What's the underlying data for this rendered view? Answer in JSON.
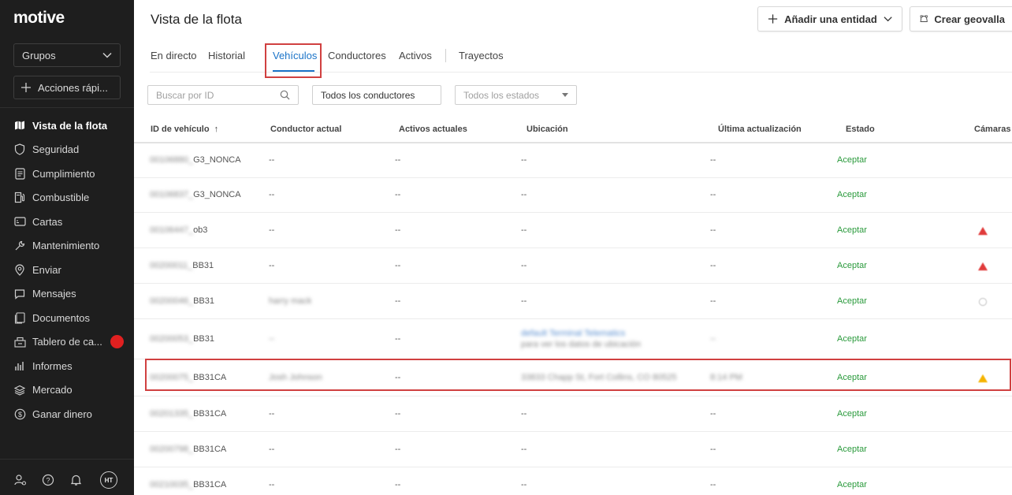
{
  "sidebar": {
    "logo": "motive",
    "groups_label": "Grupos",
    "quick_actions_label": "Acciones rápi...",
    "items": [
      {
        "label": "Vista de la flota",
        "icon": "map-icon",
        "active": true
      },
      {
        "label": "Seguridad",
        "icon": "shield-icon",
        "active": false
      },
      {
        "label": "Cumplimiento",
        "icon": "document-list-icon",
        "active": false
      },
      {
        "label": "Combustible",
        "icon": "fuel-pump-icon",
        "active": false
      },
      {
        "label": "Cartas",
        "icon": "card-icon",
        "active": false
      },
      {
        "label": "Mantenimiento",
        "icon": "wrench-icon",
        "active": false
      },
      {
        "label": "Enviar",
        "icon": "location-gear-icon",
        "active": false
      },
      {
        "label": "Mensajes",
        "icon": "message-icon",
        "active": false
      },
      {
        "label": "Documentos",
        "icon": "documents-icon",
        "active": false
      },
      {
        "label": "Tablero de ca...",
        "icon": "dashboard-icon",
        "active": false,
        "badge": true
      },
      {
        "label": "Informes",
        "icon": "bar-chart-icon",
        "active": false
      },
      {
        "label": "Mercado",
        "icon": "layers-icon",
        "active": false
      },
      {
        "label": "Ganar dinero",
        "icon": "dollar-icon",
        "active": false
      }
    ],
    "avatar_initials": "HT"
  },
  "header": {
    "title": "Vista de la flota",
    "add_entity_label": "Añadir una entidad",
    "create_geofence_label": "Crear geovalla"
  },
  "tabs": [
    {
      "label": "En directo",
      "active": false
    },
    {
      "label": "Historial",
      "active": false
    },
    {
      "label": "Vehículos",
      "active": true
    },
    {
      "label": "Conductores",
      "active": false
    },
    {
      "label": "Activos",
      "active": false
    },
    {
      "label": "Trayectos",
      "active": false
    }
  ],
  "filters": {
    "search_placeholder": "Buscar por ID",
    "drivers_value": "Todos los conductores",
    "status_placeholder": "Todos los estados"
  },
  "table": {
    "columns": [
      "ID de vehículo",
      "Conductor actual",
      "Activos actuales",
      "Ubicación",
      "Última actualización",
      "Estado",
      "Cámaras"
    ],
    "sort_indicator": "↑",
    "rows": [
      {
        "id_hidden": "00106880_",
        "id_suffix": "G3_NONCA",
        "driver": "--",
        "driver_blur": false,
        "assets": "--",
        "location": "--",
        "location2": "",
        "location_blur": false,
        "updated": "--",
        "updated_blur": false,
        "status": "Aceptar",
        "camera": "none"
      },
      {
        "id_hidden": "00106837_",
        "id_suffix": "G3_NONCA",
        "driver": "--",
        "driver_blur": false,
        "assets": "--",
        "location": "--",
        "location2": "",
        "location_blur": false,
        "updated": "--",
        "updated_blur": false,
        "status": "Aceptar",
        "camera": "none"
      },
      {
        "id_hidden": "00106447_",
        "id_suffix": "ob3",
        "driver": "--",
        "driver_blur": false,
        "assets": "--",
        "location": "--",
        "location2": "",
        "location_blur": false,
        "updated": "--",
        "updated_blur": false,
        "status": "Aceptar",
        "camera": "error"
      },
      {
        "id_hidden": "00200011_",
        "id_suffix": "BB31",
        "driver": "--",
        "driver_blur": false,
        "assets": "--",
        "location": "--",
        "location2": "",
        "location_blur": false,
        "updated": "--",
        "updated_blur": false,
        "status": "Aceptar",
        "camera": "error"
      },
      {
        "id_hidden": "00200046_",
        "id_suffix": "BB31",
        "driver": "harry mack",
        "driver_blur": true,
        "assets": "--",
        "location": "--",
        "location2": "",
        "location_blur": false,
        "updated": "--",
        "updated_blur": false,
        "status": "Aceptar",
        "camera": "offline"
      },
      {
        "id_hidden": "00200053_",
        "id_suffix": "BB31",
        "driver": "--",
        "driver_blur": true,
        "assets": "--",
        "location": "default Terminal Telematics",
        "location2": "para ver los datos de ubicación",
        "location_blur": true,
        "updated": "--",
        "updated_blur": true,
        "status": "Aceptar",
        "camera": "none"
      },
      {
        "id_hidden": "00200075_",
        "id_suffix": "BB31CA",
        "driver": "Josh Johnson",
        "driver_blur": true,
        "assets": "--",
        "location": "33833 Chapp St, Fort Collins, CO 80525",
        "location2": "",
        "location_blur": true,
        "updated": "8:14 PM",
        "updated_blur": true,
        "status": "Aceptar",
        "camera": "warning"
      },
      {
        "id_hidden": "00201335_",
        "id_suffix": "BB31CA",
        "driver": "--",
        "driver_blur": false,
        "assets": "--",
        "location": "--",
        "location2": "",
        "location_blur": false,
        "updated": "--",
        "updated_blur": false,
        "status": "Aceptar",
        "camera": "none"
      },
      {
        "id_hidden": "00200798_",
        "id_suffix": "BB31CA",
        "driver": "--",
        "driver_blur": false,
        "assets": "--",
        "location": "--",
        "location2": "",
        "location_blur": false,
        "updated": "--",
        "updated_blur": false,
        "status": "Aceptar",
        "camera": "none"
      },
      {
        "id_hidden": "00210035_",
        "id_suffix": "BB31CA",
        "driver": "--",
        "driver_blur": false,
        "assets": "--",
        "location": "--",
        "location2": "",
        "location_blur": false,
        "updated": "--",
        "updated_blur": false,
        "status": "Aceptar",
        "camera": "none"
      }
    ]
  },
  "colors": {
    "sidebar_bg": "#1e1e1e",
    "accent_blue": "#1a73c8",
    "status_green": "#2a9a3c",
    "highlight_red": "#d04040",
    "camera_error": "#e03b3b",
    "camera_warning": "#f5b400"
  }
}
